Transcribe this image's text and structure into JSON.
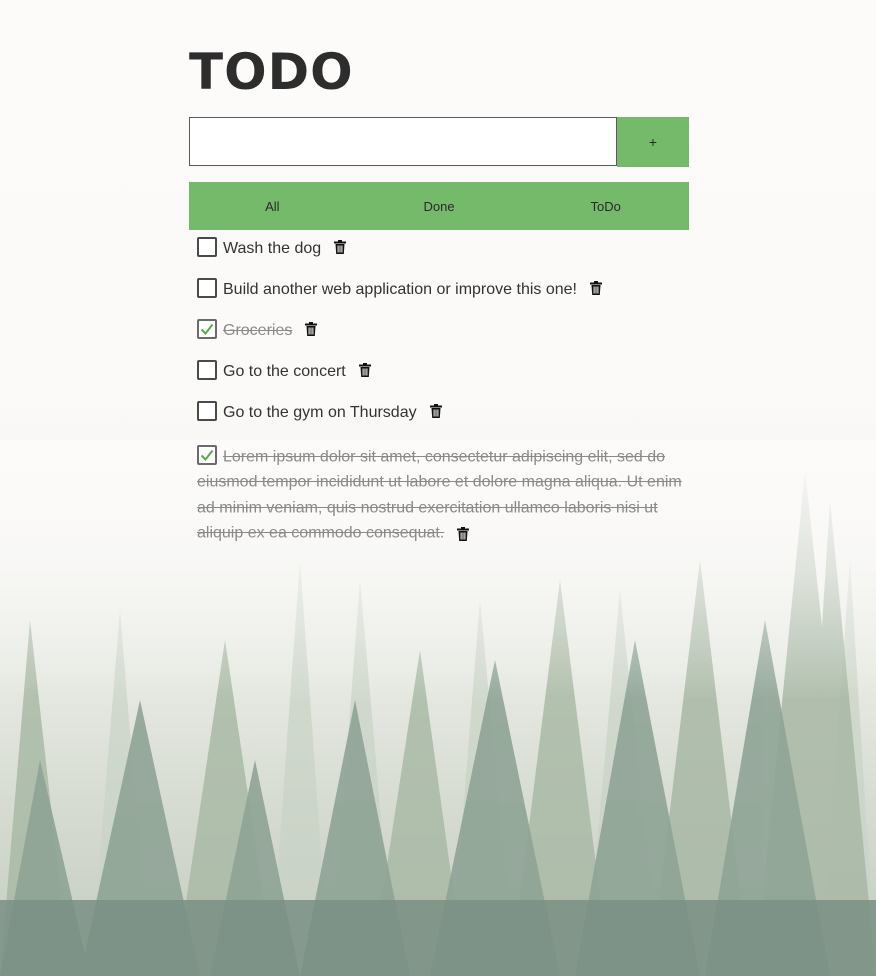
{
  "app": {
    "title": "TODO"
  },
  "add_form": {
    "input_value": "",
    "input_placeholder": "",
    "add_button_label": "+"
  },
  "filters": {
    "tabs": [
      {
        "label": "All"
      },
      {
        "label": "Done"
      },
      {
        "label": "ToDo"
      }
    ]
  },
  "todos": [
    {
      "text": "Wash the dog",
      "done": false
    },
    {
      "text": "Build another web application or improve this one!",
      "done": false
    },
    {
      "text": "Groceries",
      "done": true
    },
    {
      "text": "Go to the concert",
      "done": false
    },
    {
      "text": "Go to the gym on Thursday",
      "done": false
    },
    {
      "text": "Lorem ipsum dolor sit amet, consectetur adipiscing elit, sed do eiusmod tempor incididunt ut labore et dolore magna aliqua. Ut enim ad minim veniam, quis nostrud exercitation ullamco laboris nisi ut aliquip ex ea commodo consequat.",
      "done": true
    }
  ],
  "colors": {
    "accent": "#75b96b",
    "checkmark": "#5aa84f",
    "title": "#2d2d2d",
    "done_text": "#8a8a8a"
  },
  "icons": {
    "delete": "trash-icon",
    "checked": "checkmark-icon",
    "background": "misty-forest-image"
  }
}
